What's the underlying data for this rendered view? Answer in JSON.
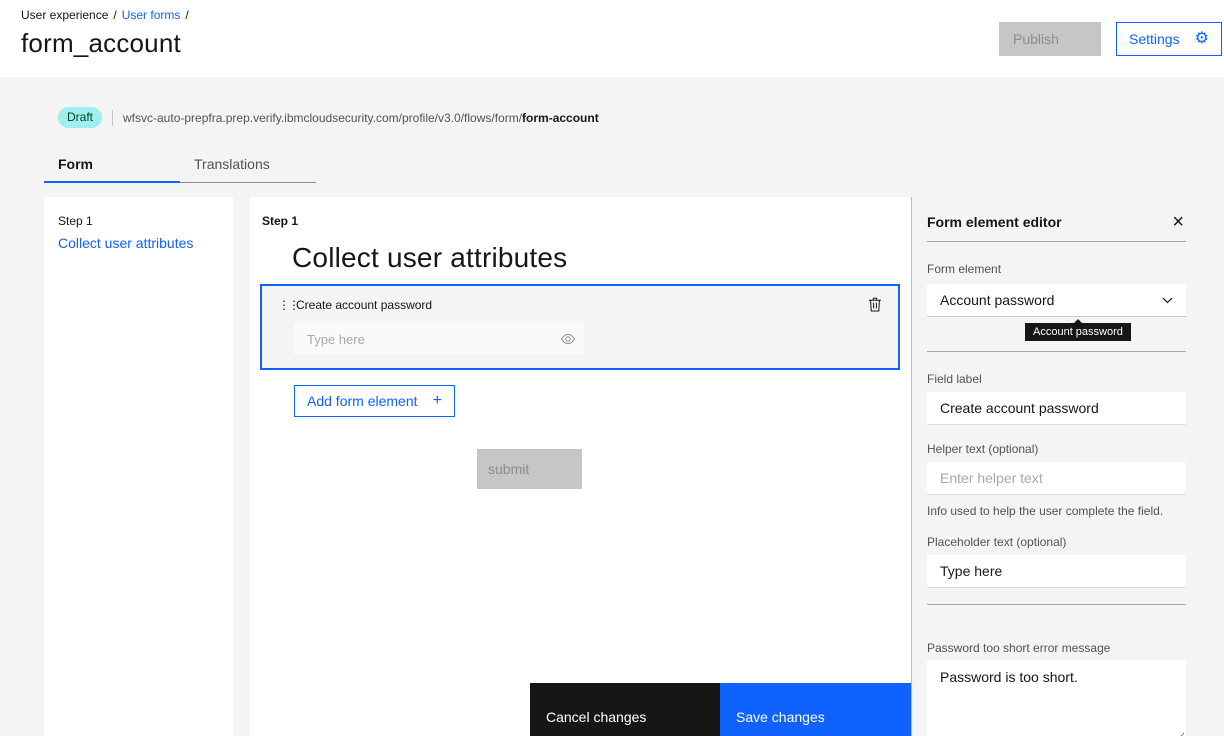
{
  "header": {
    "breadcrumb": {
      "section": "User experience",
      "link": "User forms",
      "separator": "/"
    },
    "title": "form_account",
    "publish_label": "Publish",
    "settings_label": "Settings"
  },
  "status": {
    "badge": "Draft",
    "url_prefix": "wfsvc-auto-prepfra.prep.verify.ibmcloudsecurity.com/profile/v3.0/flows/form/",
    "url_emphasis": "form-account"
  },
  "tabs": [
    {
      "label": "Form"
    },
    {
      "label": "Translations"
    }
  ],
  "steps_panel": {
    "step_label": "Step 1",
    "step_link": "Collect user attributes"
  },
  "canvas": {
    "step_label": "Step 1",
    "heading": "Collect user attributes",
    "element": {
      "label": "Create account password",
      "input_placeholder": "Type here"
    },
    "add_element_label": "Add form element",
    "submit_label": "submit",
    "cancel_label": "Cancel changes",
    "save_label": "Save changes"
  },
  "editor": {
    "title": "Form element editor",
    "form_element_label": "Form element",
    "form_element_value": "Account password",
    "tooltip": "Account password",
    "field_label": "Field label",
    "field_label_value": "Create account password",
    "helper_label": "Helper text (optional)",
    "helper_placeholder": "Enter helper text",
    "helper_info": "Info used to help the user complete the field.",
    "placeholder_label": "Placeholder text (optional)",
    "placeholder_value": "Type here",
    "error_label": "Password too short error message",
    "error_value": "Password is too short."
  },
  "icons": {
    "gear": "⚙",
    "close": "×",
    "plus": "+",
    "drag": "⋮⋮"
  },
  "colors": {
    "accent": "#0f62fe",
    "text_primary": "#161616",
    "text_secondary": "#525252",
    "surface": "#f4f4f4",
    "badge_bg": "#9ef0f0",
    "badge_text": "#044317",
    "disabled_bg": "#c6c6c6",
    "disabled_text": "#8d8d8d",
    "dark_button": "#161616"
  }
}
